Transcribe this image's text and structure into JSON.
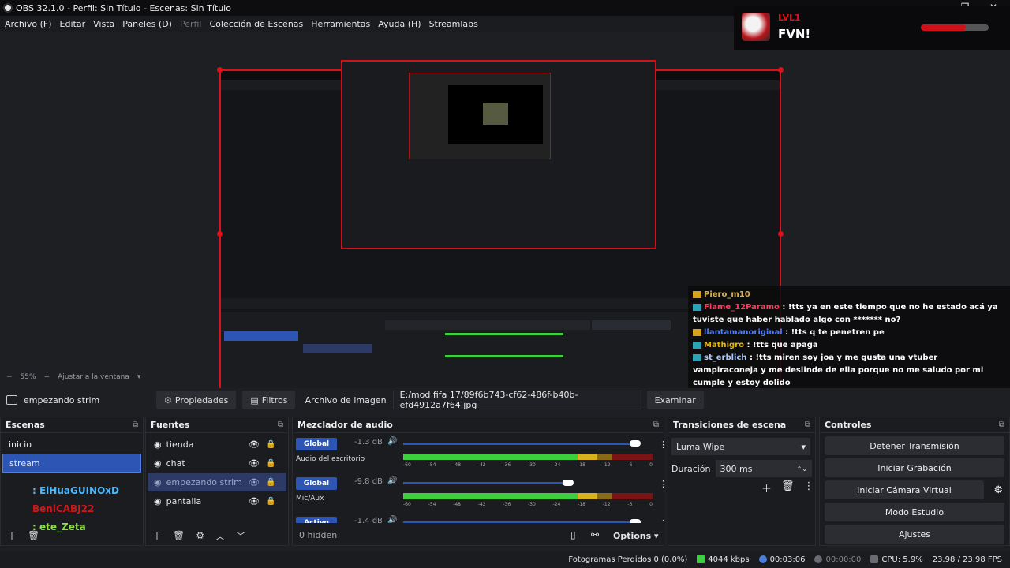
{
  "window": {
    "title": "OBS 32.1.0 - Perfil: Sin Título - Escenas: Sin Título"
  },
  "menu": [
    {
      "label": "Archivo (F)",
      "dim": false
    },
    {
      "label": "Editar",
      "dim": false
    },
    {
      "label": "Vista",
      "dim": false
    },
    {
      "label": "Paneles (D)",
      "dim": false
    },
    {
      "label": "Perfil",
      "dim": true
    },
    {
      "label": "Colección de Escenas",
      "dim": false
    },
    {
      "label": "Herramientas",
      "dim": false
    },
    {
      "label": "Ayuda (H)",
      "dim": false
    },
    {
      "label": "Streamlabs",
      "dim": false
    }
  ],
  "overlay": {
    "level": "LVL1",
    "name": "FVN!",
    "xp_fraction": 0.66
  },
  "chat": [
    {
      "user": "Piero_m10",
      "text": "",
      "user_color": "#d9b24a",
      "icon": "y"
    },
    {
      "user": "Flame_12Paramo",
      "text": ": !tts ya en este tiempo que no he estado acá ya tuviste que haber hablado algo con ******* no?",
      "user_color": "#ff3b5c",
      "icon": "b"
    },
    {
      "user": "llantamanoriginal",
      "text": ": !tts q te penetren pe",
      "user_color": "#4c7cff",
      "icon": "y"
    },
    {
      "user": "Mathigro",
      "text": ": !tts que apaga",
      "user_color": "#e5b800",
      "icon": "b"
    },
    {
      "user": "st_erblich",
      "text": ": !tts miren soy joa y me gusta una vtuber vampiraconeja y me deslinde de ella porque no me saludo por mi cumple y estoy dolido",
      "user_color": "#a8c8ff",
      "icon": "b"
    }
  ],
  "zoom": {
    "value": "55%",
    "fit": "Ajustar a la ventana"
  },
  "source_bar": {
    "source_name": "empezando strim",
    "properties": "Propiedades",
    "filters": "Filtros",
    "image_label": "Archivo de imagen",
    "image_path": "E:/mod fifa 17/89f6b743-cf62-486f-b40b-efd4912a7f64.jpg",
    "browse": "Examinar"
  },
  "scenes": {
    "title": "Escenas",
    "items": [
      {
        "label": "inicio",
        "selected": false
      },
      {
        "label": "stream",
        "selected": true
      }
    ],
    "overlay_names": [
      {
        "label": ": ElHuaGUINOxD",
        "color": "#4ab8ff"
      },
      {
        "label": "BeniCABJ22",
        "color": "#d01818"
      },
      {
        "label": ": ete_Zeta",
        "color": "#8ee04a"
      }
    ]
  },
  "sources": {
    "title": "Fuentes",
    "items": [
      {
        "label": "tienda",
        "selected": false
      },
      {
        "label": "chat",
        "selected": false
      },
      {
        "label": "empezando strim",
        "selected": true
      },
      {
        "label": "pantalla",
        "selected": false
      }
    ]
  },
  "mixer": {
    "title": "Mezclador de audio",
    "channels": [
      {
        "tag": "Global",
        "db": "-1.3 dB",
        "name": "Audio del escritorio",
        "level": 0.93
      },
      {
        "tag": "Global",
        "db": "-9.8 dB",
        "name": "Mic/Aux",
        "level": 0.66
      },
      {
        "tag": "Activo",
        "db": "-1.4 dB",
        "name": "",
        "level": 0.93
      }
    ],
    "ticks": [
      "-60",
      "-54",
      "-48",
      "-42",
      "-36",
      "-30",
      "-24",
      "-18",
      "-12",
      "-6",
      "0"
    ],
    "hidden": "0 hidden",
    "options": "Options"
  },
  "transitions": {
    "title": "Transiciones de escena",
    "selected": "Luma Wipe",
    "duration_label": "Duración",
    "duration_value": "300 ms"
  },
  "controls": {
    "title": "Controles",
    "buttons": [
      "Detener Transmisión",
      "Iniciar Grabación",
      "Iniciar Cámara Virtual",
      "Modo Estudio",
      "Ajustes"
    ]
  },
  "status": {
    "dropped": "Fotogramas Perdidos 0 (0.0%)",
    "bitrate": "4044 kbps",
    "stream_time": "00:03:06",
    "rec_time": "00:00:00",
    "cpu": "CPU: 5.9%",
    "fps": "23.98 / 23.98 FPS"
  }
}
